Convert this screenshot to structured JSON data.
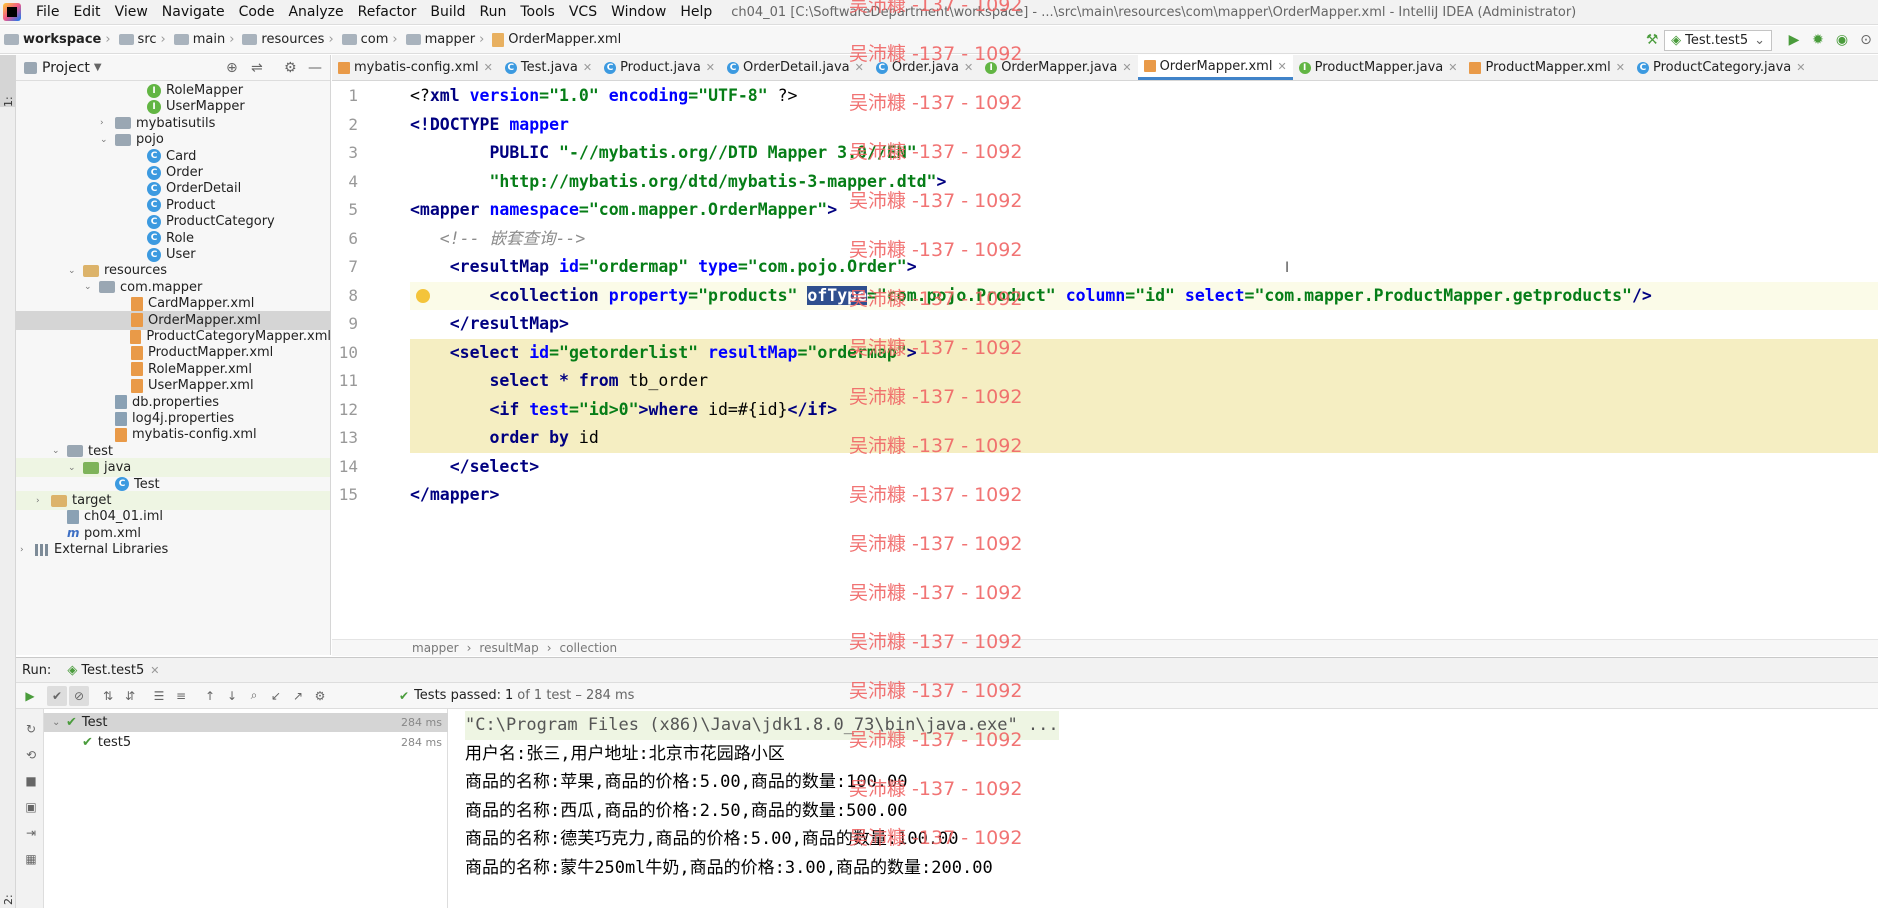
{
  "menu": {
    "items": [
      "File",
      "Edit",
      "View",
      "Navigate",
      "Code",
      "Analyze",
      "Refactor",
      "Build",
      "Run",
      "Tools",
      "VCS",
      "Window",
      "Help"
    ]
  },
  "window_title": "ch04_01 [C:\\SoftwareDepartment\\workspace] - ...\\src\\main\\resources\\com\\mapper\\OrderMapper.xml - IntelliJ IDEA (Administrator)",
  "breadcrumb": [
    "workspace",
    "src",
    "main",
    "resources",
    "com",
    "mapper",
    "OrderMapper.xml"
  ],
  "run_config": "Test.test5",
  "project": {
    "header": "Project",
    "tree": [
      {
        "label": "RoleMapper",
        "icon": "interface",
        "indent": 7,
        "arrow": ""
      },
      {
        "label": "UserMapper",
        "icon": "interface",
        "indent": 7,
        "arrow": ""
      },
      {
        "label": "mybatisutils",
        "icon": "folder",
        "indent": 5,
        "arrow": "›"
      },
      {
        "label": "pojo",
        "icon": "folder",
        "indent": 5,
        "arrow": "⌄"
      },
      {
        "label": "Card",
        "icon": "class",
        "indent": 7,
        "arrow": ""
      },
      {
        "label": "Order",
        "icon": "class",
        "indent": 7,
        "arrow": ""
      },
      {
        "label": "OrderDetail",
        "icon": "class",
        "indent": 7,
        "arrow": ""
      },
      {
        "label": "Product",
        "icon": "class",
        "indent": 7,
        "arrow": ""
      },
      {
        "label": "ProductCategory",
        "icon": "class",
        "indent": 7,
        "arrow": ""
      },
      {
        "label": "Role",
        "icon": "class",
        "indent": 7,
        "arrow": ""
      },
      {
        "label": "User",
        "icon": "class",
        "indent": 7,
        "arrow": ""
      },
      {
        "label": "resources",
        "icon": "folder-y",
        "indent": 3,
        "arrow": "⌄"
      },
      {
        "label": "com.mapper",
        "icon": "folder",
        "indent": 4,
        "arrow": "⌄"
      },
      {
        "label": "CardMapper.xml",
        "icon": "xml",
        "indent": 6,
        "arrow": ""
      },
      {
        "label": "OrderMapper.xml",
        "icon": "xml",
        "indent": 6,
        "arrow": "",
        "selected": true
      },
      {
        "label": "ProductCategoryMapper.xml",
        "icon": "xml",
        "indent": 6,
        "arrow": ""
      },
      {
        "label": "ProductMapper.xml",
        "icon": "xml",
        "indent": 6,
        "arrow": ""
      },
      {
        "label": "RoleMapper.xml",
        "icon": "xml",
        "indent": 6,
        "arrow": ""
      },
      {
        "label": "UserMapper.xml",
        "icon": "xml",
        "indent": 6,
        "arrow": ""
      },
      {
        "label": "db.properties",
        "icon": "prop",
        "indent": 5,
        "arrow": ""
      },
      {
        "label": "log4j.properties",
        "icon": "prop",
        "indent": 5,
        "arrow": ""
      },
      {
        "label": "mybatis-config.xml",
        "icon": "xml",
        "indent": 5,
        "arrow": ""
      },
      {
        "label": "test",
        "icon": "folder",
        "indent": 2,
        "arrow": "⌄"
      },
      {
        "label": "java",
        "icon": "folder-g",
        "indent": 3,
        "arrow": "⌄",
        "highlight": true
      },
      {
        "label": "Test",
        "icon": "class",
        "indent": 5,
        "arrow": ""
      },
      {
        "label": "target",
        "icon": "folder-y",
        "indent": 1,
        "arrow": "›",
        "highlight": true
      },
      {
        "label": "ch04_01.iml",
        "icon": "iml",
        "indent": 2,
        "arrow": ""
      },
      {
        "label": "pom.xml",
        "icon": "maven",
        "indent": 2,
        "arrow": ""
      },
      {
        "label": "External Libraries",
        "icon": "lib",
        "indent": 0,
        "arrow": "›"
      }
    ]
  },
  "tabs": [
    {
      "label": "mybatis-config.xml",
      "icon": "xml"
    },
    {
      "label": "Test.java",
      "icon": "class"
    },
    {
      "label": "Product.java",
      "icon": "class"
    },
    {
      "label": "OrderDetail.java",
      "icon": "class"
    },
    {
      "label": "Order.java",
      "icon": "class"
    },
    {
      "label": "OrderMapper.java",
      "icon": "interface"
    },
    {
      "label": "OrderMapper.xml",
      "icon": "xml",
      "active": true
    },
    {
      "label": "ProductMapper.java",
      "icon": "interface"
    },
    {
      "label": "ProductMapper.xml",
      "icon": "xml"
    },
    {
      "label": "ProductCategory.java",
      "icon": "class"
    }
  ],
  "code": {
    "lines": [
      "1",
      "2",
      "3",
      "4",
      "5",
      "6",
      "7",
      "8",
      "9",
      "10",
      "11",
      "12",
      "13",
      "14",
      "15"
    ]
  },
  "editor_breadcrumb": [
    "mapper",
    "resultMap",
    "collection"
  ],
  "run": {
    "label": "Run:",
    "config_tab": "Test.test5",
    "status_prefix": "Tests passed:",
    "status_count": "1",
    "status_suffix": "of 1 test – 284 ms",
    "tree": [
      {
        "label": "Test",
        "time": "284 ms"
      },
      {
        "label": "test5",
        "time": "284 ms"
      }
    ],
    "console": [
      "\"C:\\Program Files (x86)\\Java\\jdk1.8.0_73\\bin\\java.exe\" ...",
      "用户名:张三,用户地址:北京市花园路小区",
      "商品的名称:苹果,商品的价格:5.00,商品的数量:100.00",
      "商品的名称:西瓜,商品的价格:2.50,商品的数量:500.00",
      "商品的名称:德芙巧克力,商品的价格:5.00,商品的数量:100.00",
      "商品的名称:蒙牛250ml牛奶,商品的价格:3.00,商品的数量:200.00"
    ]
  },
  "watermark": "吴沛糠 -137 - 1092",
  "colors": {
    "tag": "#000080",
    "attr": "#0000ff",
    "value": "#067d17",
    "comment": "#8c8c8c",
    "highlight": "#f5eec2",
    "watermark": "#f06565",
    "active_tab": "#4083c9"
  }
}
